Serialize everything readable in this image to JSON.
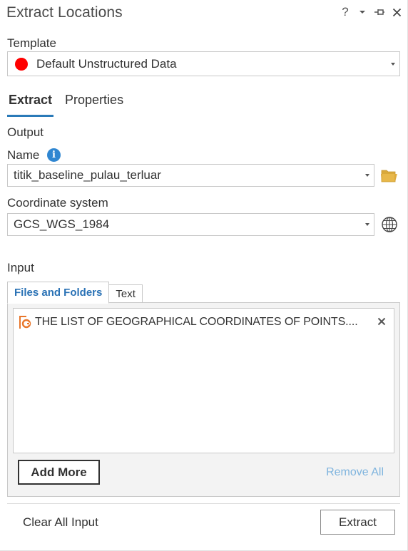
{
  "window": {
    "title": "Extract Locations",
    "help_glyph": "?",
    "controls": [
      "help-icon",
      "menu-chevron-icon",
      "pin-icon",
      "close-icon"
    ]
  },
  "template": {
    "label": "Template",
    "selected": "Default Unstructured Data",
    "swatch_color": "#ff0000"
  },
  "tabs": [
    {
      "label": "Extract",
      "active": true
    },
    {
      "label": "Properties",
      "active": false
    }
  ],
  "output": {
    "section_label": "Output",
    "name_label": "Name",
    "info_glyph": "i",
    "name_value": "titik_baseline_pulau_terluar",
    "coord_label": "Coordinate system",
    "coord_value": "GCS_WGS_1984"
  },
  "input": {
    "section_label": "Input",
    "tabs": [
      {
        "label": "Files and Folders",
        "active": true
      },
      {
        "label": "Text",
        "active": false
      }
    ],
    "files": [
      {
        "name": "THE LIST OF GEOGRAPHICAL COORDINATES OF POINTS....",
        "icon": "pdf-icon"
      }
    ],
    "add_more_label": "Add More",
    "remove_all_label": "Remove All"
  },
  "footer": {
    "clear_label": "Clear All Input",
    "extract_label": "Extract"
  },
  "colors": {
    "accent": "#2a7ab8",
    "info": "#2f86d1",
    "link_disabled": "#7fb4de",
    "folder": "#e8b84a"
  }
}
